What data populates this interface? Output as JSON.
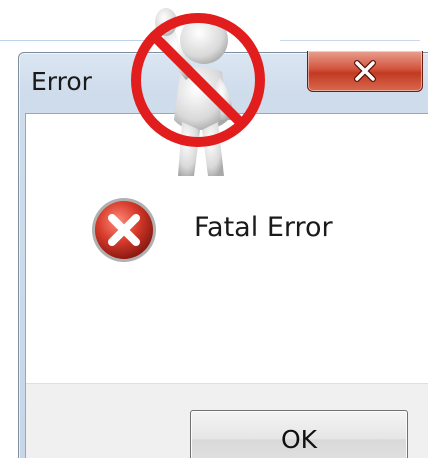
{
  "window": {
    "title": "Error",
    "close_icon": "close-x-icon"
  },
  "dialog": {
    "icon": "error-x-icon",
    "message": "Fatal Error",
    "ok_label": "OK"
  },
  "illustration": {
    "icon": "stop-hand-figure-icon"
  },
  "colors": {
    "close_button": "#c9432b",
    "error_icon": "#c62828",
    "prohibition": "#e11d1d",
    "footer": "#f0f0f0"
  }
}
